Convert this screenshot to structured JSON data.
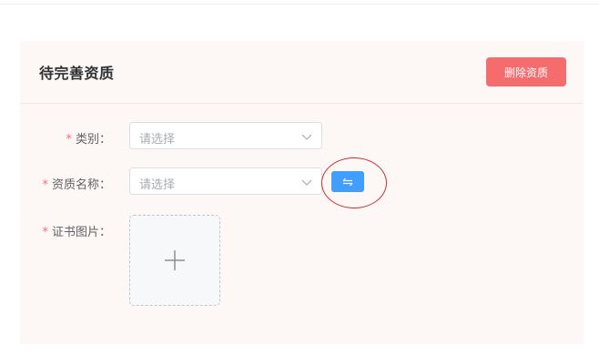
{
  "card": {
    "title": "待完善资质",
    "delete_label": "删除资质"
  },
  "form": {
    "category": {
      "required_mark": "*",
      "label": "类别：",
      "placeholder": "请选择"
    },
    "qualification_name": {
      "required_mark": "*",
      "label": "资质名称：",
      "placeholder": "请选择",
      "switch_icon": "swap-arrows-icon"
    },
    "certificate_image": {
      "required_mark": "*",
      "label": "证书图片：",
      "upload_icon": "plus-icon"
    }
  },
  "colors": {
    "accent": "#409eff",
    "danger": "#f56c6c",
    "annotation": "#d42a2a"
  }
}
